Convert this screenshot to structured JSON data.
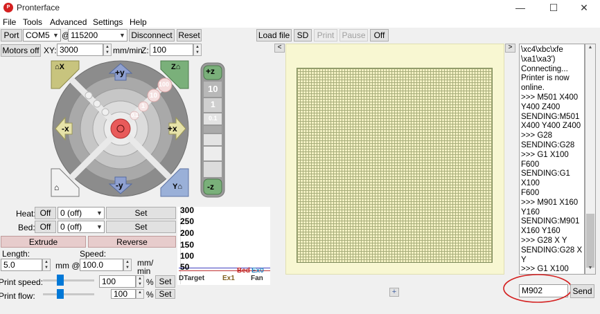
{
  "window": {
    "title": "Pronterface",
    "app_icon": "pronterface-icon",
    "controls": [
      "—",
      "☐",
      "✕"
    ]
  },
  "menu": [
    "File",
    "Tools",
    "Advanced",
    "Settings",
    "Help"
  ],
  "toolbar": {
    "port_label": "Port",
    "port_value": "COM5",
    "at": "@",
    "baud_value": "115200",
    "disconnect_label": "Disconnect",
    "reset_label": "Reset",
    "loadfile_label": "Load file",
    "sd_label": "SD",
    "print_label": "Print",
    "pause_label": "Pause",
    "off_label": "Off"
  },
  "motors": {
    "motors_off_label": "Motors off",
    "xy_label": "XY:",
    "xy_value": "3000",
    "mm_min_label": "mm/min",
    "z_label": "Z:",
    "z_value": "100"
  },
  "jog": {
    "home_x": "X",
    "home_y": "Y",
    "home_z": "Z",
    "plus_y": "+y",
    "minus_y": "-y",
    "plus_x": "+x",
    "minus_x": "-x",
    "step100": "100",
    "step10": "10",
    "step1": "1",
    "step01": "0.1",
    "z_plus": "+z",
    "z_minus": "-z",
    "z10": "10",
    "z1": "1",
    "z01": "0.1"
  },
  "temps": {
    "heat_label": "Heat:",
    "heat_off": "Off",
    "heat_value": "0 (off)",
    "heat_set": "Set",
    "bed_label": "Bed:",
    "bed_off": "Off",
    "bed_value": "0 (off)",
    "bed_set": "Set"
  },
  "extrude": {
    "extrude_label": "Extrude",
    "reverse_label": "Reverse",
    "length_label": "Length:",
    "speed_label": "Speed:",
    "length_value": "5.0",
    "mm_at": "mm @",
    "speed_value": "100.0",
    "unit_mm": "mm/",
    "unit_min": "min"
  },
  "speeds": {
    "print_speed_label": "Print speed:",
    "print_speed_value": "100",
    "print_flow_label": "Print flow:",
    "print_flow_value": "100",
    "pct": "%",
    "set_label": "Set",
    "print_speed_level": 0.19,
    "print_flow_level": 0.19
  },
  "tempgraph": {
    "ticks": [
      "300",
      "250",
      "200",
      "150",
      "100",
      "50"
    ],
    "legend": [
      "Target",
      "Ex1",
      "Bed",
      "Ex0",
      "Fan"
    ],
    "target_prefix": "D"
  },
  "nav": {
    "left_arrow": "<",
    "right_arrow": ">",
    "plus": "+"
  },
  "console": {
    "log": "\\xc4\\xbc\\xfe\n\\xa1\\xa3')\nConnecting...\nPrinter is now\nonline.\n>>> M501 X400\nY400 Z400\nSENDING:M501\nX400 Y400 Z400\n>>> G28\nSENDING:G28\n>>> G1 X100\nF600\nSENDING:G1 X100\nF600\n>>> M901 X160\nY160\nSENDING:M901\nX160 Y160\n>>> G28 X Y\nSENDING:G28 X Y\n>>> G1 X100\nF1000\nSENDING:G1 X100\nF1000\n>>> M902\nSENDING:M902",
    "input_value": "M902",
    "send_label": "Send"
  },
  "colors": {
    "highlight_circle": "#d42020",
    "jog_center": "#e85a5a",
    "grid_bg": "#f4f1c4"
  }
}
